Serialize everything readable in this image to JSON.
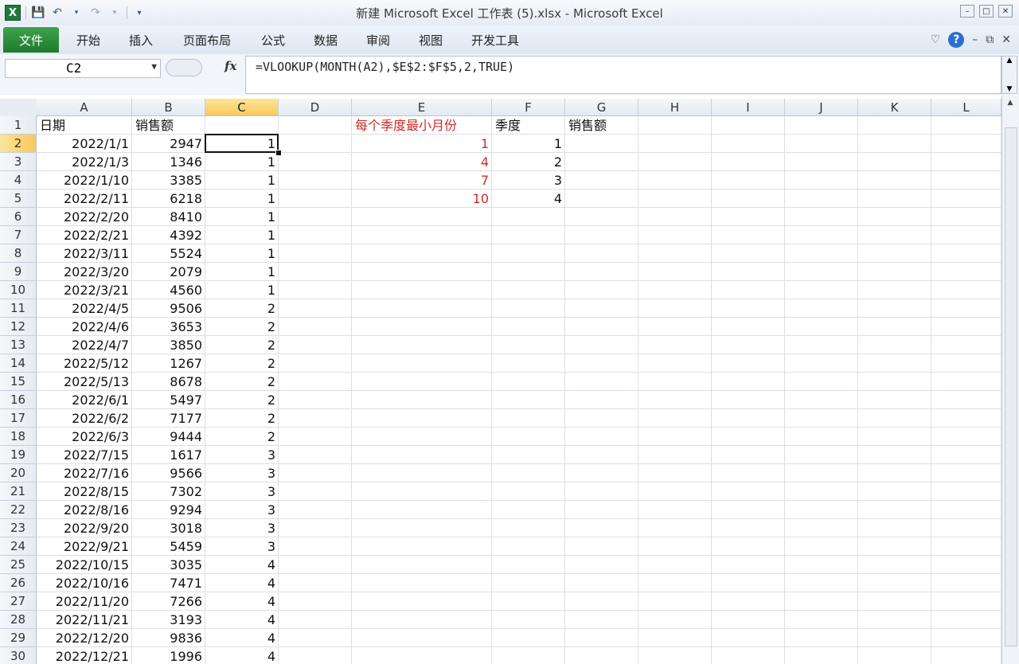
{
  "app": {
    "title": "新建 Microsoft Excel 工作表 (5).xlsx - Microsoft Excel",
    "logo_letter": "X",
    "qat_icons": [
      "save-icon",
      "undo-icon",
      "redo-icon",
      "customize-icon"
    ]
  },
  "ribbon": {
    "file_tab": "文件",
    "tabs": [
      "开始",
      "插入",
      "页面布局",
      "公式",
      "数据",
      "审阅",
      "视图",
      "开发工具"
    ],
    "help_label": "?"
  },
  "formula_bar": {
    "name_box": "C2",
    "fx_label": "fx",
    "formula": "=VLOOKUP(MONTH(A2),$E$2:$F$5,2,TRUE)"
  },
  "columns": [
    "A",
    "B",
    "C",
    "D",
    "E",
    "F",
    "G",
    "H",
    "I",
    "J",
    "K",
    "L"
  ],
  "selected_column": "C",
  "selected_row": 2,
  "rows": [
    1,
    2,
    3,
    4,
    5,
    6,
    7,
    8,
    9,
    10,
    11,
    12,
    13,
    14,
    15,
    16,
    17,
    18,
    19,
    20,
    21,
    22,
    23,
    24,
    25,
    26,
    27,
    28,
    29,
    30
  ],
  "headers": {
    "A1": "日期",
    "B1": "销售额",
    "E1": "每个季度最小月份",
    "F1": "季度",
    "G1": "销售额"
  },
  "sales_table": [
    {
      "date": "2022/1/1",
      "amount": "2947",
      "quarter": "1"
    },
    {
      "date": "2022/1/3",
      "amount": "1346",
      "quarter": "1"
    },
    {
      "date": "2022/1/10",
      "amount": "3385",
      "quarter": "1"
    },
    {
      "date": "2022/2/11",
      "amount": "6218",
      "quarter": "1"
    },
    {
      "date": "2022/2/20",
      "amount": "8410",
      "quarter": "1"
    },
    {
      "date": "2022/2/21",
      "amount": "4392",
      "quarter": "1"
    },
    {
      "date": "2022/3/11",
      "amount": "5524",
      "quarter": "1"
    },
    {
      "date": "2022/3/20",
      "amount": "2079",
      "quarter": "1"
    },
    {
      "date": "2022/3/21",
      "amount": "4560",
      "quarter": "1"
    },
    {
      "date": "2022/4/5",
      "amount": "9506",
      "quarter": "2"
    },
    {
      "date": "2022/4/6",
      "amount": "3653",
      "quarter": "2"
    },
    {
      "date": "2022/4/7",
      "amount": "3850",
      "quarter": "2"
    },
    {
      "date": "2022/5/12",
      "amount": "1267",
      "quarter": "2"
    },
    {
      "date": "2022/5/13",
      "amount": "8678",
      "quarter": "2"
    },
    {
      "date": "2022/6/1",
      "amount": "5497",
      "quarter": "2"
    },
    {
      "date": "2022/6/2",
      "amount": "7177",
      "quarter": "2"
    },
    {
      "date": "2022/6/3",
      "amount": "9444",
      "quarter": "2"
    },
    {
      "date": "2022/7/15",
      "amount": "1617",
      "quarter": "3"
    },
    {
      "date": "2022/7/16",
      "amount": "9566",
      "quarter": "3"
    },
    {
      "date": "2022/8/15",
      "amount": "7302",
      "quarter": "3"
    },
    {
      "date": "2022/8/16",
      "amount": "9294",
      "quarter": "3"
    },
    {
      "date": "2022/9/20",
      "amount": "3018",
      "quarter": "3"
    },
    {
      "date": "2022/9/21",
      "amount": "5459",
      "quarter": "3"
    },
    {
      "date": "2022/10/15",
      "amount": "3035",
      "quarter": "4"
    },
    {
      "date": "2022/10/16",
      "amount": "7471",
      "quarter": "4"
    },
    {
      "date": "2022/11/20",
      "amount": "7266",
      "quarter": "4"
    },
    {
      "date": "2022/11/21",
      "amount": "3193",
      "quarter": "4"
    },
    {
      "date": "2022/12/20",
      "amount": "9836",
      "quarter": "4"
    },
    {
      "date": "2022/12/21",
      "amount": "1996",
      "quarter": "4"
    }
  ],
  "lookup_table": [
    {
      "min_month": "1",
      "quarter": "1"
    },
    {
      "min_month": "4",
      "quarter": "2"
    },
    {
      "min_month": "7",
      "quarter": "3"
    },
    {
      "min_month": "10",
      "quarter": "4"
    }
  ],
  "colors": {
    "accent_red": "#d22a2a",
    "file_tab_green": "#1f7a2e",
    "selected_header": "#f7c95a"
  }
}
